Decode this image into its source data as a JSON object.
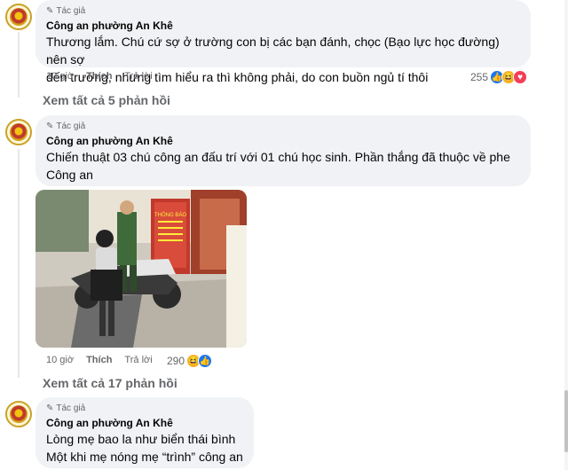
{
  "comments": [
    {
      "badge": "Tác giả",
      "author": "Công an phường An Khê",
      "lines": [
        "Thương lắm. Chú cứ sợ ở trường con bị các bạn đánh, chọc (Bạo lực học đường) nên sợ",
        "đến trường, nhưng tìm hiểu ra thì không phải, do con buồn ngủ tí thôi"
      ],
      "time": "10 giờ",
      "like_label": "Thích",
      "reply_label": "Trả lời",
      "reaction_count": "255",
      "reactions": [
        "like-icon",
        "haha-icon",
        "love-icon"
      ],
      "view_replies": "Xem tất cả 5 phản hồi"
    },
    {
      "badge": "Tác giả",
      "author": "Công an phường An Khê",
      "lines": [
        "Chiến thuật 03 chú công an đấu trí với 01 chú học sinh. Phần thắng đã thuộc về phe",
        "Công an"
      ],
      "photo_sign_title": "THÔNG BÁO",
      "time": "10 giờ",
      "like_label": "Thích",
      "reply_label": "Trả lời",
      "reaction_count": "290",
      "reactions": [
        "haha-icon",
        "like-icon"
      ],
      "view_replies": "Xem tất cả 17 phản hồi"
    },
    {
      "badge": "Tác giả",
      "author": "Công an phường An Khê",
      "lines": [
        "Lòng mẹ bao la như biển thái bình",
        "Một khi mẹ nóng mẹ “trình” công an"
      ]
    }
  ],
  "colors": {
    "bubble": "#f0f2f5",
    "meta": "#65676b",
    "like": "#1877f2",
    "haha": "#f7b125",
    "love": "#f33e58"
  }
}
